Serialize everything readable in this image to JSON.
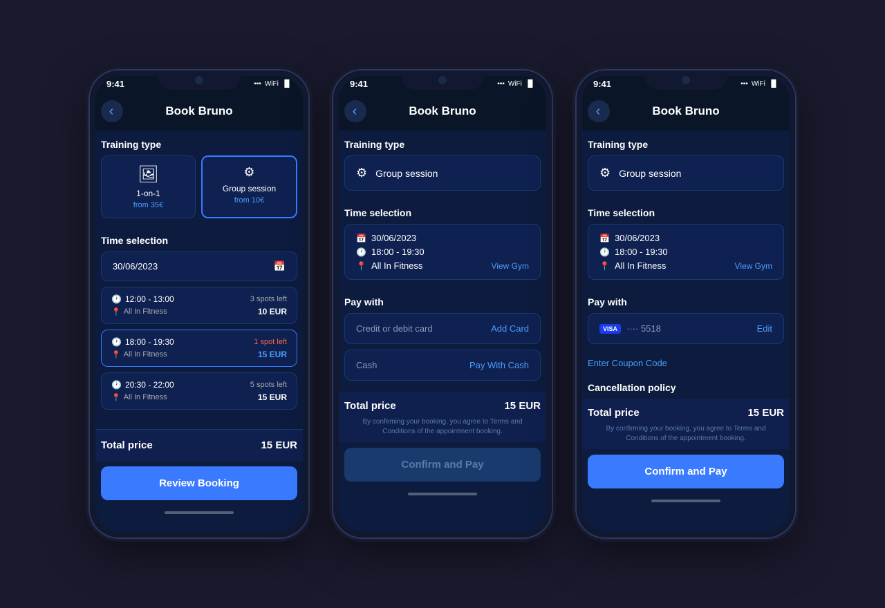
{
  "phones": [
    {
      "id": "phone1",
      "statusTime": "9:41",
      "title": "Book Bruno",
      "screen": "booking",
      "trainingTypes": [
        {
          "id": "1on1",
          "icon": "🖼",
          "name": "1-on-1",
          "price": "from 35€",
          "active": false
        },
        {
          "id": "group",
          "icon": "🏋",
          "name": "Group session",
          "price": "from 10€",
          "active": true
        }
      ],
      "sectionLabels": {
        "trainingType": "Training type",
        "timeSelection": "Time selection"
      },
      "dateInput": "30/06/2023",
      "timeSlots": [
        {
          "time": "12:00 - 13:00",
          "spots": "3 spots left",
          "location": "All In Fitness",
          "price": "10 EUR",
          "priceColor": "white",
          "active": false
        },
        {
          "time": "18:00 - 19:30",
          "spots": "1 spot left",
          "location": "All In Fitness",
          "price": "15 EUR",
          "priceColor": "blue",
          "active": true
        },
        {
          "time": "20:30 - 22:00",
          "spots": "5 spots left",
          "location": "All In Fitness",
          "price": "15 EUR",
          "priceColor": "white",
          "active": false
        }
      ],
      "totalLabel": "Total price",
      "totalAmount": "15 EUR",
      "ctaLabel": "Review Booking"
    },
    {
      "id": "phone2",
      "statusTime": "9:41",
      "title": "Book Bruno",
      "screen": "payment",
      "sectionLabels": {
        "trainingType": "Training type",
        "timeSelection": "Time selection",
        "payWith": "Pay with"
      },
      "selectedTraining": "Group session",
      "timeDetails": {
        "date": "30/06/2023",
        "time": "18:00 - 19:30",
        "location": "All In Fitness",
        "viewGym": "View Gym"
      },
      "payOptions": [
        {
          "label": "Credit or debit card",
          "action": "Add Card",
          "type": "card"
        },
        {
          "label": "Cash",
          "action": "Pay With Cash",
          "type": "cash"
        }
      ],
      "totalLabel": "Total price",
      "totalAmount": "15 EUR",
      "disclaimer": "By confirming your booking, you agree to Terms and Conditions of the appointment booking.",
      "ctaLabel": "Confirm and Pay",
      "ctaDisabled": true
    },
    {
      "id": "phone3",
      "statusTime": "9:41",
      "title": "Book Bruno",
      "screen": "payment-card",
      "sectionLabels": {
        "trainingType": "Training type",
        "timeSelection": "Time selection",
        "payWith": "Pay with",
        "cancellationPolicy": "Cancellation policy"
      },
      "selectedTraining": "Group session",
      "timeDetails": {
        "date": "30/06/2023",
        "time": "18:00 - 19:30",
        "location": "All In Fitness",
        "viewGym": "View Gym"
      },
      "payOptions": [
        {
          "label": "···· 5518",
          "action": "Edit",
          "type": "visa"
        }
      ],
      "couponLabel": "Enter Coupon Code",
      "totalLabel": "Total price",
      "totalAmount": "15 EUR",
      "disclaimer": "By confirming your booking, you agree to Terms and Conditions of the appointment booking.",
      "ctaLabel": "Confirm and Pay",
      "ctaDisabled": false
    }
  ]
}
